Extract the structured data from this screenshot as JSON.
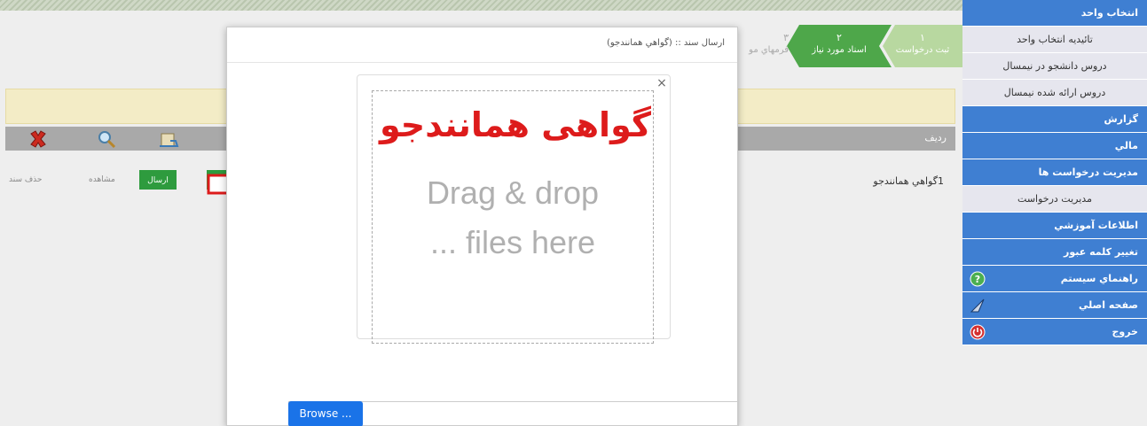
{
  "sidebar": {
    "items": [
      {
        "label": "انتخاب واحد",
        "style": "dark"
      },
      {
        "label": "تائيديه انتخاب واحد",
        "style": "light"
      },
      {
        "label": "دروس دانشجو در نيمسال",
        "style": "light"
      },
      {
        "label": "دروس ارائه شده نيمسال",
        "style": "light"
      },
      {
        "label": "گزارش",
        "style": "dark"
      },
      {
        "label": "مالي",
        "style": "dark"
      },
      {
        "label": "مديريت درخواست ها",
        "style": "dark"
      },
      {
        "label": "مديريت درخواست",
        "style": "light"
      },
      {
        "label": "اطلاعات آموزشي",
        "style": "dark"
      },
      {
        "label": "تغيير كلمه عبور",
        "style": "dark"
      },
      {
        "label": "راهنماي سيستم",
        "style": "dark",
        "icon": "help-icon"
      },
      {
        "label": "صفحه اصلي",
        "style": "dark",
        "icon": "home-icon"
      },
      {
        "label": "خروج",
        "style": "dark",
        "icon": "power-icon"
      }
    ]
  },
  "steps": {
    "step1": {
      "num": "۱",
      "label": "ثبت درخواست"
    },
    "step2": {
      "num": "۲",
      "label": "اسناد مورد نياز"
    },
    "step3": {
      "num": "۳",
      "label": "فرمهاي مو"
    }
  },
  "table": {
    "col_radif": "رديف",
    "row": {
      "num": "1",
      "title": "گواهي همانندجو"
    }
  },
  "toolbar": {
    "delete_label": "حذف سند",
    "view_label": "مشاهده",
    "send_label": "ارسال"
  },
  "modal": {
    "title": "ارسال سند :: (گواهي همانندجو)",
    "close": "×",
    "heading": "گواهی همانندجو",
    "drop_line1": "Drag & drop",
    "drop_line2": "... files here",
    "browse_label": "Browse ..."
  },
  "colors": {
    "sidebar_dark": "#3f7fd2",
    "step_active": "#4ea74a",
    "heading_red": "#dd1b1b",
    "browse_blue": "#1a73e8"
  }
}
